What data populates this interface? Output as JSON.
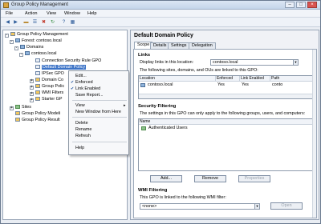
{
  "window": {
    "title": "Group Policy Management"
  },
  "menu": [
    "File",
    "Action",
    "View",
    "Window",
    "Help"
  ],
  "tree": {
    "root": "Group Policy Management",
    "forest": "Forest: contoso.local",
    "domains": "Domains",
    "domain": "contoso.local",
    "items": [
      "Connection Security Rule GPO",
      "Default Domain Policy",
      "IPSec GPO",
      "Domain Co",
      "Group Polic",
      "WMI Filters",
      "Starter GP"
    ],
    "sites": "Sites",
    "modeling": "Group Policy Modeli",
    "results": "Group Policy Result"
  },
  "context_menu": {
    "edit": "Edit...",
    "enforced": "Enforced",
    "link_enabled": "Link Enabled",
    "save_report": "Save Report...",
    "view": "View",
    "new_window": "New Window from Here",
    "delete": "Delete",
    "rename": "Rename",
    "refresh": "Refresh",
    "help": "Help"
  },
  "details": {
    "title": "Default Domain Policy",
    "tabs": [
      "Scope",
      "Details",
      "Settings",
      "Delegation"
    ],
    "links_header": "Links",
    "display_links_label": "Display links in this location:",
    "display_links_value": "contoso.local",
    "linked_text": "The following sites, domains, and OUs are linked to this GPO:",
    "columns": [
      "Location",
      "Enforced",
      "Link Enabled",
      "Path"
    ],
    "rows": [
      {
        "location": "contoso.local",
        "enforced": "Yes",
        "link_enabled": "Yes",
        "path": "conto"
      }
    ],
    "security_header": "Security Filtering",
    "security_text": "The settings in this GPO can only apply to the following groups, users, and computers:",
    "name_column": "Name",
    "security_items": [
      "Authenticated Users"
    ],
    "add_label": "Add...",
    "remove_label": "Remove",
    "properties_label": "Properties",
    "wmi_header": "WMI Filtering",
    "wmi_text": "This GPO is linked to the following WMI filter:",
    "wmi_value": "<none>",
    "open_label": "Open"
  }
}
